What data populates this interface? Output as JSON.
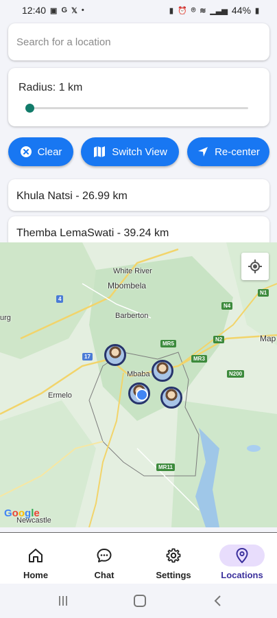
{
  "status_bar": {
    "time": "12:40",
    "battery": "44%"
  },
  "search": {
    "placeholder": "Search for a location",
    "value": ""
  },
  "radius": {
    "label": "Radius: 1 km",
    "slider_fraction": 0.0
  },
  "buttons": {
    "clear": "Clear",
    "switch_view": "Switch View",
    "recenter": "Re-center"
  },
  "locations": [
    {
      "label": "Khula Natsi - 26.99 km"
    },
    {
      "label": "Themba LemaSwati - 39.24 km"
    }
  ],
  "map": {
    "places": [
      "White River",
      "Mbombela",
      "Barberton",
      "Mbaba",
      "Ermelo",
      "Newcastle",
      "Map",
      "urg"
    ],
    "road_labels": [
      "4",
      "17",
      "MR5",
      "MR3",
      "N2",
      "N4",
      "N1",
      "MR11",
      "N200"
    ],
    "attribution": "Google"
  },
  "bottom_nav": [
    {
      "label": "Home",
      "icon": "home-icon",
      "active": false
    },
    {
      "label": "Chat",
      "icon": "chat-icon",
      "active": false
    },
    {
      "label": "Settings",
      "icon": "gear-icon",
      "active": false
    },
    {
      "label": "Locations",
      "icon": "location-pin-icon",
      "active": true
    }
  ],
  "colors": {
    "primary": "#1877f2",
    "slider": "#127b6a",
    "nav_active_bg": "#e8ddfc",
    "nav_active_text": "#3a2f9c"
  }
}
